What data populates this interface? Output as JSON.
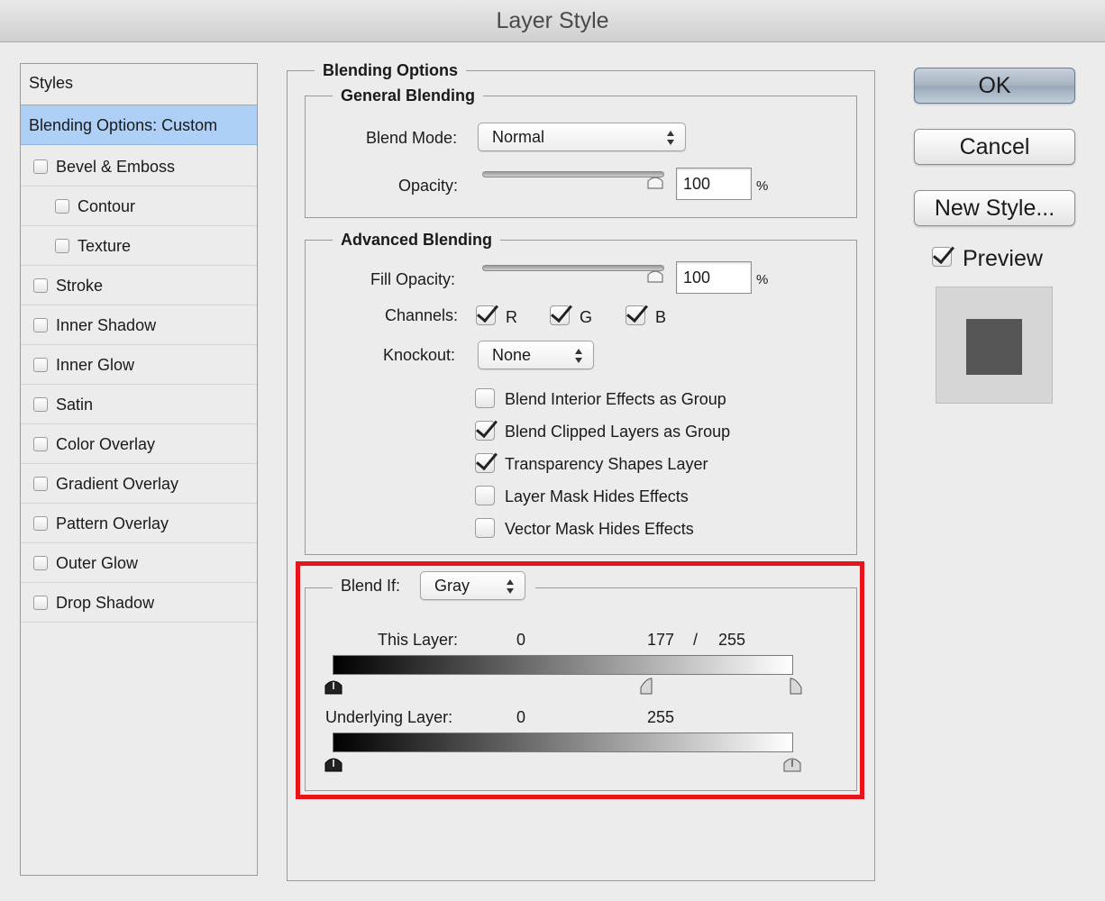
{
  "window": {
    "title": "Layer Style"
  },
  "sidebar": {
    "header": "Styles",
    "selected": "Blending Options: Custom",
    "items": [
      {
        "label": "Bevel & Emboss",
        "checked": false,
        "indent": false
      },
      {
        "label": "Contour",
        "checked": false,
        "indent": true
      },
      {
        "label": "Texture",
        "checked": false,
        "indent": true
      },
      {
        "label": "Stroke",
        "checked": false,
        "indent": false
      },
      {
        "label": "Inner Shadow",
        "checked": false,
        "indent": false
      },
      {
        "label": "Inner Glow",
        "checked": false,
        "indent": false
      },
      {
        "label": "Satin",
        "checked": false,
        "indent": false
      },
      {
        "label": "Color Overlay",
        "checked": false,
        "indent": false
      },
      {
        "label": "Gradient Overlay",
        "checked": false,
        "indent": false
      },
      {
        "label": "Pattern Overlay",
        "checked": false,
        "indent": false
      },
      {
        "label": "Outer Glow",
        "checked": false,
        "indent": false
      },
      {
        "label": "Drop Shadow",
        "checked": false,
        "indent": false
      }
    ]
  },
  "blending_options": {
    "title": "Blending Options",
    "general": {
      "title": "General Blending",
      "blend_mode_label": "Blend Mode:",
      "blend_mode_value": "Normal",
      "opacity_label": "Opacity:",
      "opacity_value": "100",
      "opacity_unit": "%",
      "opacity_level": 1.0
    },
    "advanced": {
      "title": "Advanced Blending",
      "fill_opacity_label": "Fill Opacity:",
      "fill_opacity_value": "100",
      "fill_opacity_unit": "%",
      "fill_opacity_level": 1.0,
      "channels_label": "Channels:",
      "channels": [
        {
          "label": "R",
          "checked": true
        },
        {
          "label": "G",
          "checked": true
        },
        {
          "label": "B",
          "checked": true
        }
      ],
      "knockout_label": "Knockout:",
      "knockout_value": "None",
      "options": [
        {
          "label": "Blend Interior Effects as Group",
          "checked": false
        },
        {
          "label": "Blend Clipped Layers as Group",
          "checked": true
        },
        {
          "label": "Transparency Shapes Layer",
          "checked": true
        },
        {
          "label": "Layer Mask Hides Effects",
          "checked": false
        },
        {
          "label": "Vector Mask Hides Effects",
          "checked": false
        }
      ]
    },
    "blend_if": {
      "label": "Blend If:",
      "value": "Gray",
      "this_layer_label": "This Layer:",
      "this_layer_low": "0",
      "this_layer_mid": "177",
      "this_layer_sep": "/",
      "this_layer_high": "255",
      "underlying_label": "Underlying Layer:",
      "underlying_low": "0",
      "underlying_high": "255"
    }
  },
  "buttons": {
    "ok": "OK",
    "cancel": "Cancel",
    "new_style": "New Style..."
  },
  "preview": {
    "label": "Preview",
    "checked": true
  },
  "colors": {
    "highlight": "#e8141b",
    "selected": "#aed0f7",
    "swatch": "#555555"
  }
}
